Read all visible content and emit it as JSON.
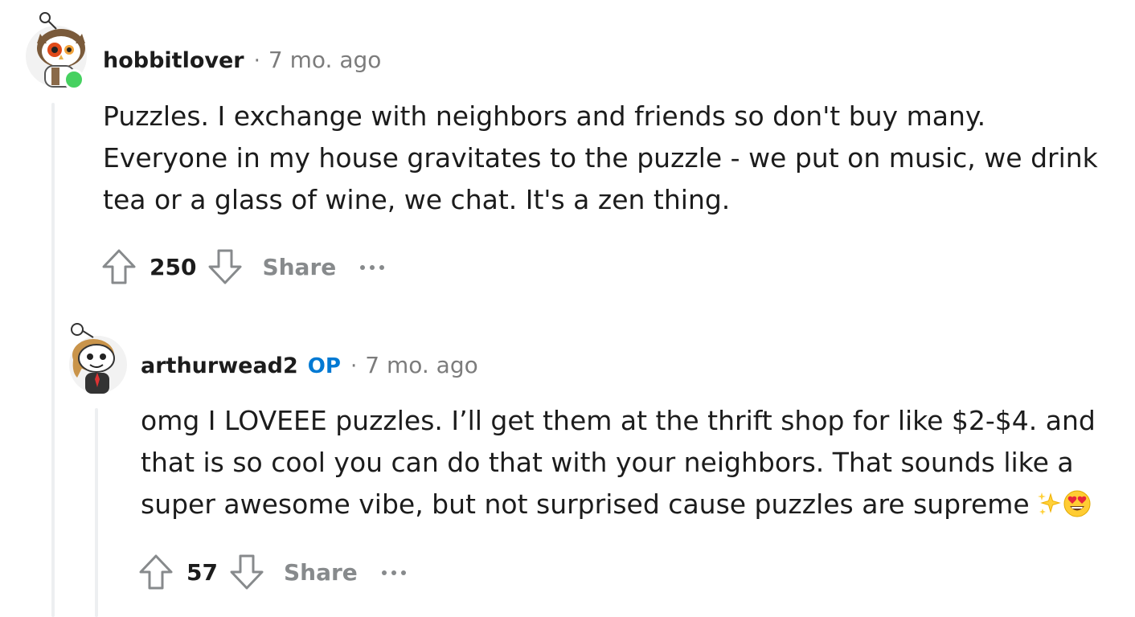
{
  "comments": [
    {
      "username": "hobbitlover",
      "op_label": "",
      "separator": "·",
      "timestamp": "7 mo. ago",
      "avatar_icon": "owl-snoo-avatar",
      "online": true,
      "body_lines": [
        "Puzzles. I exchange with neighbors and friends so don't buy many.",
        "Everyone in my house gravitates to the puzzle - we put on music, we drink",
        "tea or a glass of wine, we chat. It's a zen thing."
      ],
      "votes": "250",
      "share_label": "Share",
      "more_icon": "ellipsis-icon"
    },
    {
      "username": "arthurwead2",
      "op_label": "OP",
      "separator": "·",
      "timestamp": "7 mo. ago",
      "avatar_icon": "snoo-avatar",
      "online": false,
      "body_lines": [
        "omg I LOVEEE puzzles. I’ll get them at the thrift shop for like $2-$4. and",
        "that is so cool you can do that with your neighbors. That sounds like a",
        "super awesome vibe, but not surprised cause puzzles are supreme"
      ],
      "emojis": [
        "sparkles",
        "heart-eyes"
      ],
      "votes": "57",
      "share_label": "Share",
      "more_icon": "ellipsis-icon"
    }
  ],
  "colors": {
    "online": "#46d160",
    "op_badge": "#0079d3",
    "muted": "#878a8c",
    "thread_line": "#edeff1"
  }
}
